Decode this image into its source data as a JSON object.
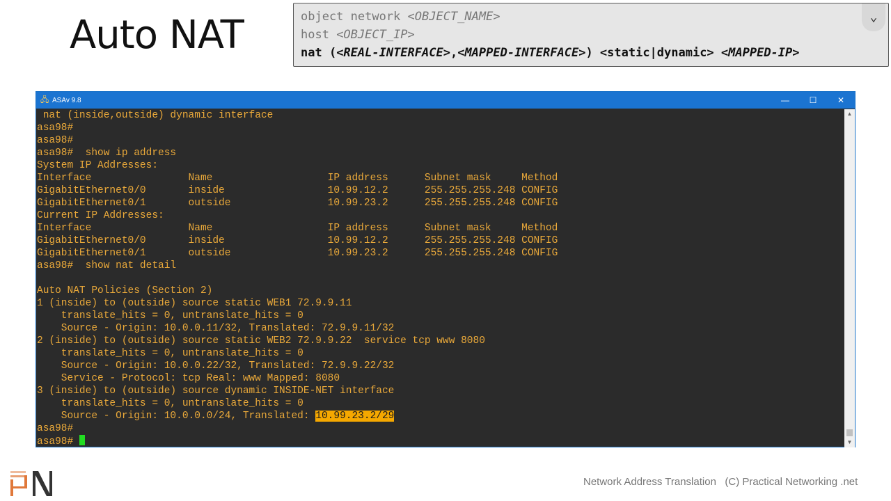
{
  "slide_title": "Auto NAT",
  "syntax": {
    "line1": [
      "object network ",
      "<OBJECT_NAME>"
    ],
    "line2": [
      " host ",
      "<OBJECT_IP>"
    ],
    "line3": [
      "nat (",
      "<REAL-INTERFACE>",
      ",",
      "<MAPPED-INTERFACE>",
      ") <static|dynamic> ",
      "<MAPPED-IP>"
    ],
    "expand_icon": "chevron-down-icon"
  },
  "window": {
    "title": "ASAv 9.8",
    "minimize": "—",
    "maximize": "☐",
    "close": "✕"
  },
  "terminal": {
    "lines": [
      " nat (inside,outside) dynamic interface",
      "asa98#",
      "asa98#",
      "asa98#  show ip address",
      "System IP Addresses:",
      "Interface                Name                   IP address      Subnet mask     Method",
      "GigabitEthernet0/0       inside                 10.99.12.2      255.255.255.248 CONFIG",
      "GigabitEthernet0/1       outside                10.99.23.2      255.255.255.248 CONFIG",
      "Current IP Addresses:",
      "Interface                Name                   IP address      Subnet mask     Method",
      "GigabitEthernet0/0       inside                 10.99.12.2      255.255.255.248 CONFIG",
      "GigabitEthernet0/1       outside                10.99.23.2      255.255.255.248 CONFIG",
      "asa98#  show nat detail",
      "",
      "Auto NAT Policies (Section 2)",
      "1 (inside) to (outside) source static WEB1 72.9.9.11",
      "    translate_hits = 0, untranslate_hits = 0",
      "    Source - Origin: 10.0.0.11/32, Translated: 72.9.9.11/32",
      "2 (inside) to (outside) source static WEB2 72.9.9.22  service tcp www 8080",
      "    translate_hits = 0, untranslate_hits = 0",
      "    Source - Origin: 10.0.0.22/32, Translated: 72.9.9.22/32",
      "    Service - Protocol: tcp Real: www Mapped: 8080",
      "3 (inside) to (outside) source dynamic INSIDE-NET interface",
      "    translate_hits = 0, untranslate_hits = 0",
      "    Source - Origin: 10.0.0.0/24, Translated: ",
      "asa98#",
      "asa98# "
    ],
    "highlighted": "10.99.23.2/29"
  },
  "footer": "Network Address Translation   (C) Practical Networking .net",
  "logo_text": "PN"
}
